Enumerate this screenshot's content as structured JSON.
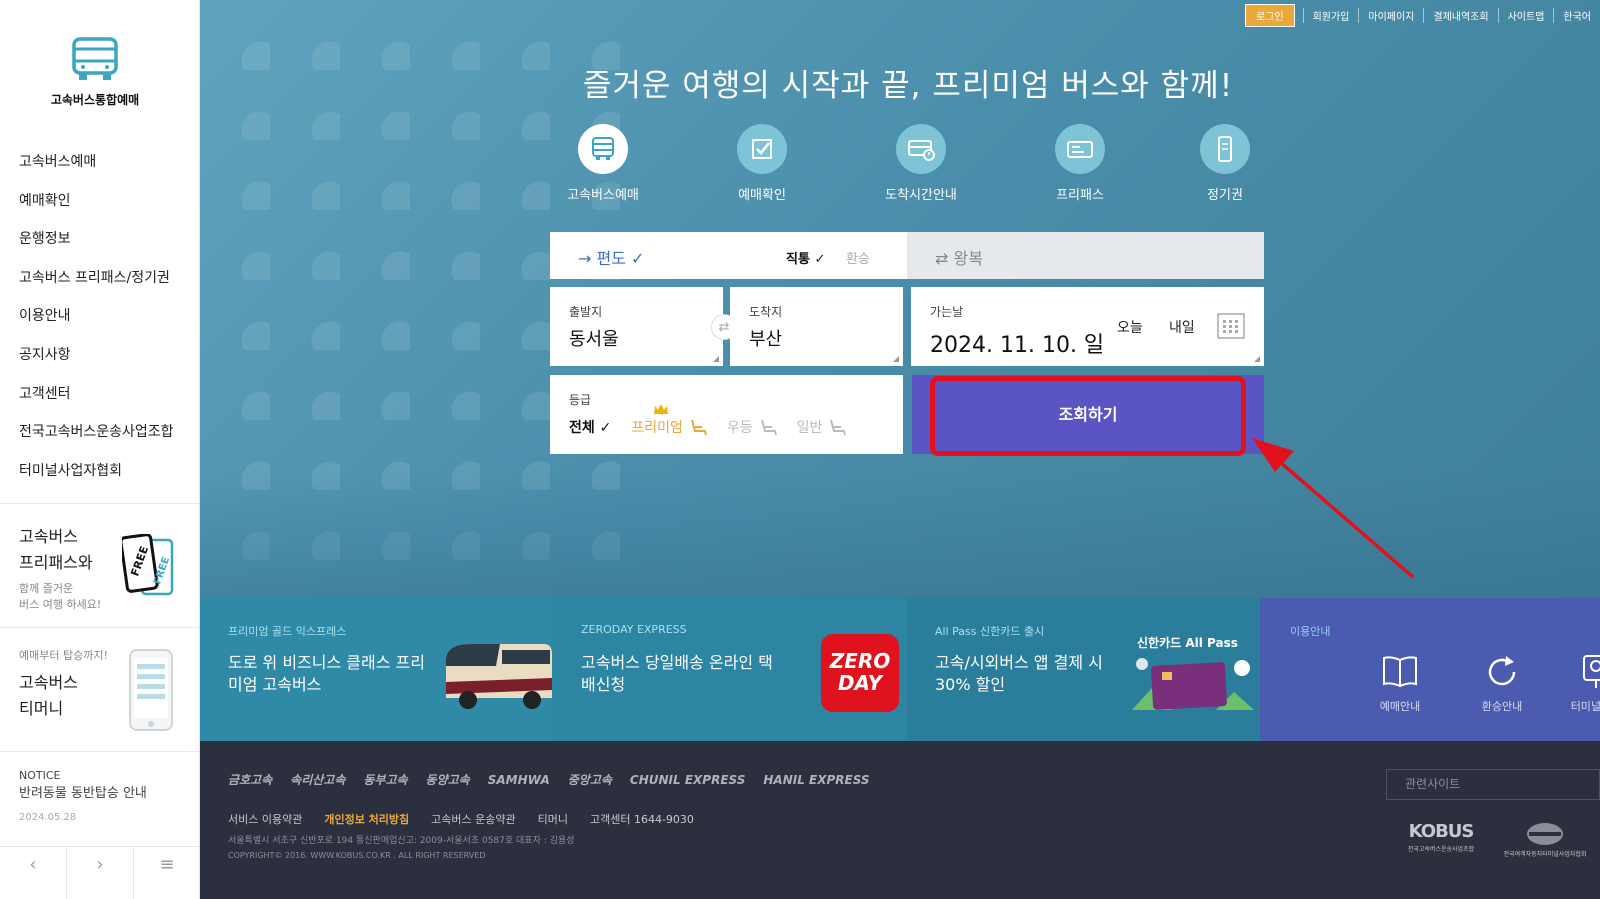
{
  "sidebar": {
    "logo_text": "고속버스통합예매",
    "menu": [
      "고속버스예매",
      "예매확인",
      "운행정보",
      "고속버스 프리패스/정기권",
      "이용안내",
      "공지사항",
      "고객센터",
      "전국고속버스운송사업조합",
      "터미널사업자협회"
    ],
    "card1": {
      "title_1": "고속버스",
      "title_2": "프리패스와",
      "sub_1": "함께 즐거운",
      "sub_2": "버스 여행 하세요!"
    },
    "card2": {
      "sub": "예매부터 탑승까지!",
      "title_1": "고속버스",
      "title_2": "티머니"
    },
    "card3": {
      "label": "NOTICE",
      "title": "반려동물 동반탑승 안내",
      "date": "2024.05.28"
    },
    "bottom": {
      "prev": "‹",
      "next": "›",
      "menu": "≡"
    }
  },
  "toplinks": {
    "login": "로그인",
    "items": [
      "회원가입",
      "마이페이지",
      "결제내역조회",
      "사이트맵",
      "한국어"
    ]
  },
  "headline": "즐거운 여행의 시작과 끝, 프리미엄 버스와 함께!",
  "services": [
    {
      "label": "고속버스예매",
      "icon": "bus-icon"
    },
    {
      "label": "예매확인",
      "icon": "check-icon"
    },
    {
      "label": "도착시간안내",
      "icon": "bus-time-icon"
    },
    {
      "label": "프리패스",
      "icon": "freepass-icon"
    },
    {
      "label": "정기권",
      "icon": "ticket-icon"
    }
  ],
  "trip": {
    "oneway": "→ 편도 ✓",
    "direct": "직통 ✓",
    "transfer": "환승",
    "roundtrip": "⇄ 왕복"
  },
  "depart": {
    "caption": "출발지",
    "value": "동서울"
  },
  "arrive": {
    "caption": "도착지",
    "value": "부산"
  },
  "date": {
    "caption": "가는날",
    "value": "2024. 11. 10. 일",
    "today": "오늘",
    "tomorrow": "내일"
  },
  "grade": {
    "caption": "등급",
    "all": "전체 ✓",
    "premium": "프리미엄",
    "excellent": "우등",
    "normal": "일반"
  },
  "search_button": "조회하기",
  "colors": {
    "accent_orange": "#e8a93a",
    "search_button": "#5b54c4",
    "highlight_red": "#e1121d",
    "hero_blue": "#4a8eab"
  },
  "promos": [
    {
      "tag": "프리미엄 골드 익스프레스",
      "text": "도로 위 비즈니스 클래스 프리미엄 고속버스"
    },
    {
      "tag": "ZERODAY EXPRESS",
      "text": "고속버스 당일배송 온라인 택배신청",
      "logo_1": "ZERO",
      "logo_2": "DAY"
    },
    {
      "tag": "All Pass 신한카드 출시",
      "text": "고속/시외버스 앱 결제 시 30% 할인",
      "card_title": "신한카드 All Pass"
    },
    {
      "tag": "이용안내",
      "items": [
        "예매안내",
        "환승안내",
        "터미널안내"
      ]
    }
  ],
  "footer": {
    "brands": [
      "금호고속",
      "속리산고속",
      "동부고속",
      "동양고속",
      "SAMHWA",
      "중앙고속",
      "CHUNIL EXPRESS",
      "HANIL EXPRESS"
    ],
    "links": [
      "서비스 이용약관",
      "개인정보 처리방침",
      "고속버스 운송약관",
      "티머니",
      "고객센터 1644-9030"
    ],
    "address": "서울특별시 서초구 신반포로 194 통신판매업신고: 2009-서울서초 0587호 대표자 : 김용성",
    "copyright": "COPYRIGHT© 2016. WWW.KOBUS.CO.KR . ALL RIGHT RESERVED",
    "related": "관련사이트",
    "kobus": "KOBUS",
    "kobus_sub": "전국고속버스운송사업조합",
    "assoc_sub": "전국여객자동차터미널사업자협회"
  }
}
